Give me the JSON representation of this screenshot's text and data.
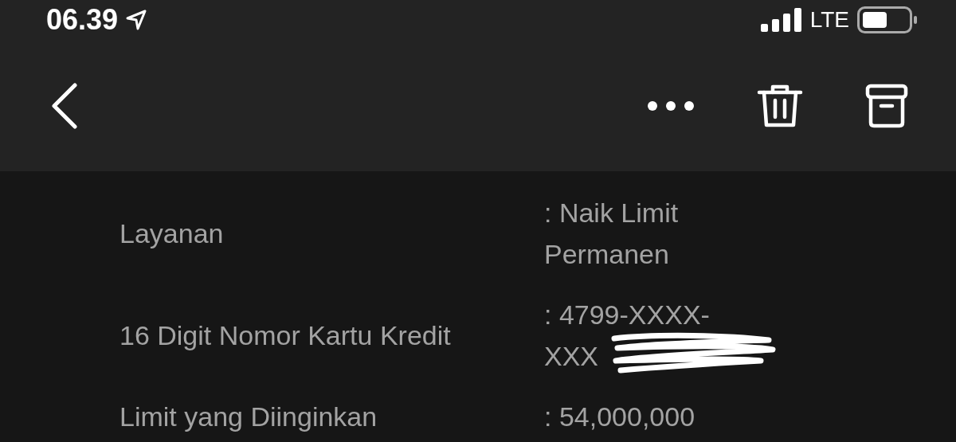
{
  "status_bar": {
    "time": "06.39",
    "network": "LTE"
  },
  "fields": [
    {
      "label": "Layanan",
      "value_lines": [
        ": Naik Limit",
        "Permanen"
      ],
      "redacted": false
    },
    {
      "label": "16 Digit Nomor Kartu Kredit",
      "value_lines": [
        ": 4799-XXXX-",
        "XXX"
      ],
      "redacted": true
    },
    {
      "label": "Limit yang Diinginkan",
      "value_lines": [
        ": 54,000,000"
      ],
      "redacted": false
    }
  ]
}
